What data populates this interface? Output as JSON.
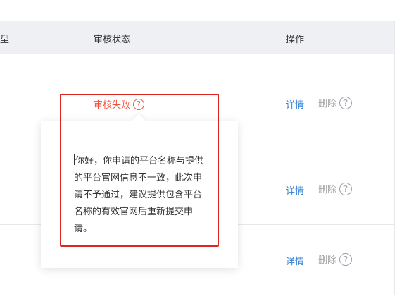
{
  "table": {
    "headers": {
      "type_partial": "型",
      "review_status": "审核状态",
      "actions": "操作"
    },
    "rows": [
      {
        "status": "审核失败",
        "detail": "详情",
        "delete": "删除"
      },
      {
        "detail": "详情",
        "delete": "删除"
      },
      {
        "detail": "详情",
        "delete": "删除"
      }
    ]
  },
  "popover": {
    "message": "你好，你申请的平台名称与提供的平台官网信息不一致，此次申请不予通过，建议提供包含平台名称的有效官网后重新提交申请。"
  },
  "icons": {
    "help": "question-circle-icon"
  },
  "colors": {
    "status_fail": "#f0503c",
    "link": "#2f7fd6",
    "disabled": "#a6a6a6",
    "highlight": "#e02323",
    "header_bg": "#eef0f3"
  }
}
